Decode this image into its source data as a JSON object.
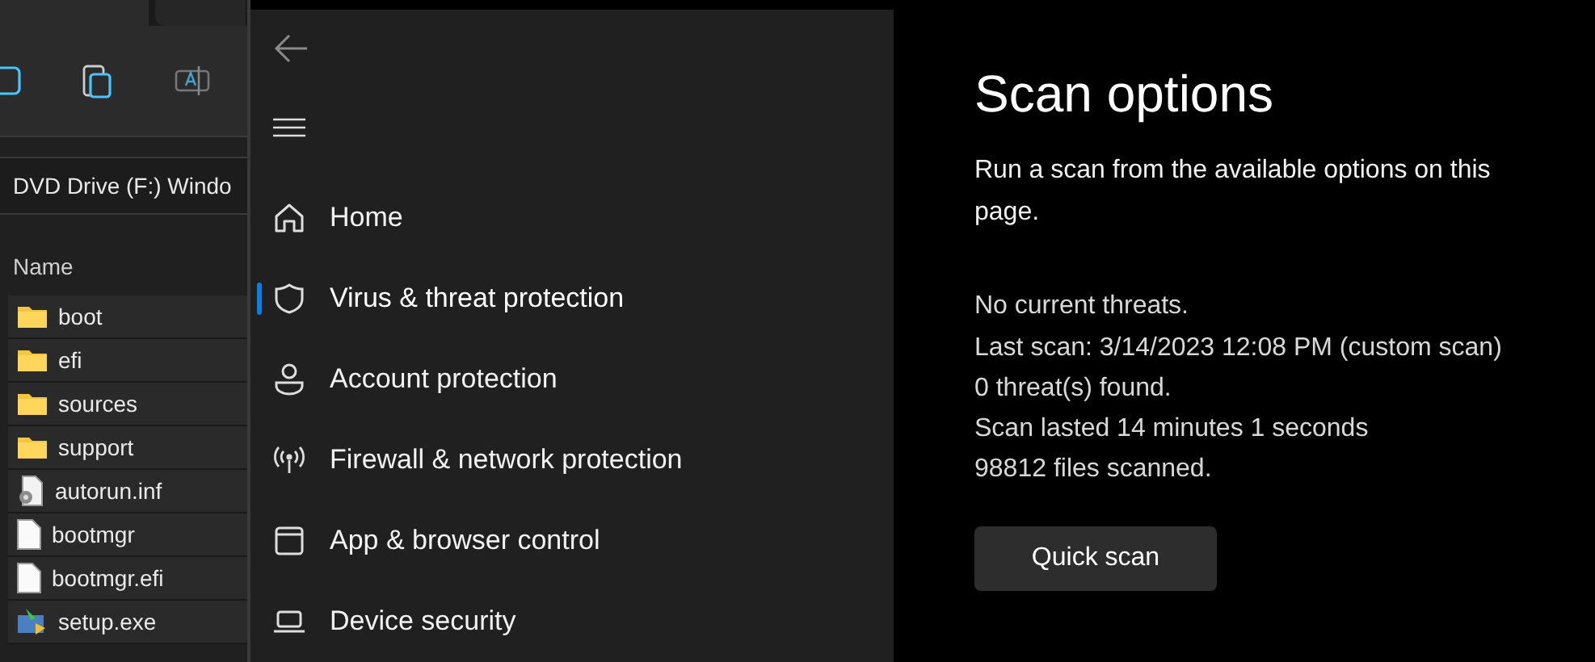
{
  "explorer": {
    "address": "DVD Drive (F:) Windo",
    "column_header": "Name",
    "files": [
      {
        "name": "boot",
        "kind": "folder"
      },
      {
        "name": "efi",
        "kind": "folder"
      },
      {
        "name": "sources",
        "kind": "folder"
      },
      {
        "name": "support",
        "kind": "folder"
      },
      {
        "name": "autorun.inf",
        "kind": "settings"
      },
      {
        "name": "bootmgr",
        "kind": "file"
      },
      {
        "name": "bootmgr.efi",
        "kind": "file"
      },
      {
        "name": "setup.exe",
        "kind": "installer"
      }
    ]
  },
  "nav": {
    "items": [
      {
        "label": "Home",
        "selected": false
      },
      {
        "label": "Virus & threat protection",
        "selected": true
      },
      {
        "label": "Account protection",
        "selected": false
      },
      {
        "label": "Firewall & network protection",
        "selected": false
      },
      {
        "label": "App & browser control",
        "selected": false
      },
      {
        "label": "Device security",
        "selected": false
      }
    ]
  },
  "content": {
    "title": "Scan options",
    "description": "Run a scan from the available options on this page.",
    "status": "No current threats.",
    "details": [
      "Last scan: 3/14/2023 12:08 PM (custom scan)",
      "0 threat(s) found.",
      "Scan lasted 14 minutes 1 seconds",
      "98812 files scanned."
    ],
    "button": "Quick scan"
  }
}
